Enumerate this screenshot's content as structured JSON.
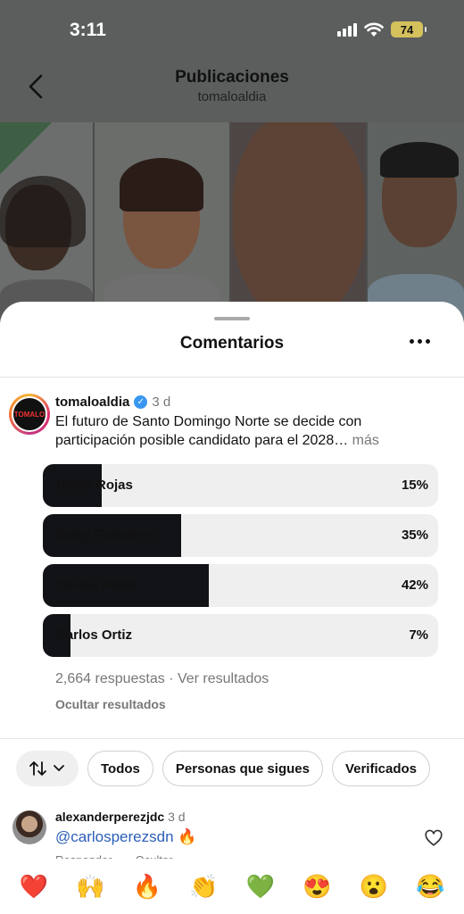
{
  "status_bar": {
    "time": "3:11",
    "battery": "74"
  },
  "nav": {
    "title": "Publicaciones",
    "subtitle": "tomaloaldia"
  },
  "sheet": {
    "title": "Comentarios"
  },
  "post": {
    "username": "tomaloaldia",
    "time": "3 d",
    "text": "El futuro de Santo Domingo Norte se decide con participación posible candidato para el 2028…",
    "more": "más",
    "avatar_text": "TOMALO"
  },
  "poll": {
    "options": [
      {
        "label": "Dulce Rojas",
        "percent": "15%",
        "value": 15
      },
      {
        "label": "Betty Geronimo",
        "percent": "35%",
        "value": 35
      },
      {
        "label": "Carlos Pérez",
        "percent": "42%",
        "value": 42
      },
      {
        "label": "Carlos Ortiz",
        "percent": "7%",
        "value": 7
      }
    ],
    "responses": "2,664 respuestas · Ver resultados",
    "hide": "Ocultar resultados"
  },
  "filters": {
    "all": "Todos",
    "following": "Personas que sigues",
    "verified": "Verificados"
  },
  "comment": {
    "username": "alexanderperezjdc",
    "time": "3 d",
    "mention": "@carlosperezsdn",
    "emoji": "🔥",
    "reply": "Responder",
    "hide": "Ocultar"
  },
  "emoji_bar": [
    "❤️",
    "🙌",
    "🔥",
    "👏",
    "💚",
    "😍",
    "😮",
    "😂"
  ],
  "colors": {
    "poll_fill": "#121316",
    "poll_track": "#efefef",
    "mention": "#2b5fb8",
    "verified": "#3897f0"
  }
}
